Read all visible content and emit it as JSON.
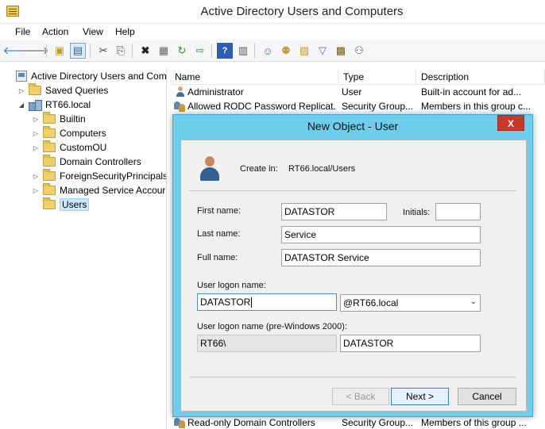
{
  "window": {
    "title": "Active Directory Users and Computers"
  },
  "menu": [
    "File",
    "Action",
    "View",
    "Help"
  ],
  "toolbar": {
    "icons": [
      "back-arrow-icon",
      "forward-arrow-icon",
      "up-folder-icon",
      "show-console-tree-icon",
      "cut-icon",
      "copy-icon",
      "delete-icon",
      "properties-icon",
      "refresh-icon",
      "export-list-icon",
      "help-icon",
      "action-pane-icon",
      "new-user-icon",
      "new-group-icon",
      "new-ou-icon",
      "filter-icon",
      "find-icon",
      "add-to-group-icon"
    ]
  },
  "tree": {
    "root": "Active Directory Users and Com",
    "saved_queries": "Saved Queries",
    "domain": "RT66.local",
    "children": [
      "Builtin",
      "Computers",
      "CustomOU",
      "Domain Controllers",
      "ForeignSecurityPrincipals",
      "Managed Service Accour",
      "Users"
    ]
  },
  "list": {
    "columns": {
      "name": "Name",
      "type": "Type",
      "description": "Description"
    },
    "rows": [
      {
        "name": "Administrator",
        "type": "User",
        "description": "Built-in account for ad..."
      },
      {
        "name": "Allowed RODC Password Replicat...",
        "type": "Security Group...",
        "description": "Members in this group c..."
      },
      {
        "name": "Read-only Domain Controllers",
        "type": "Security Group...",
        "description": "Members of this group ..."
      }
    ]
  },
  "dialog": {
    "title": "New Object - User",
    "close_glyph": "X",
    "create_in_label": "Create in:",
    "create_in_value": "RT66.local/Users",
    "first_name_label": "First name:",
    "first_name_value": "DATASTOR",
    "initials_label": "Initials:",
    "initials_value": "",
    "last_name_label": "Last name:",
    "last_name_value": "Service",
    "full_name_label": "Full name:",
    "full_name_value": "DATASTOR Service",
    "logon_label": "User logon name:",
    "logon_value": "DATASTOR",
    "domain_suffix": "@RT66.local",
    "pre2000_label": "User logon name (pre-Windows 2000):",
    "pre2000_domain": "RT66\\",
    "pre2000_value": "DATASTOR",
    "back_label": "< Back",
    "next_label": "Next >",
    "cancel_label": "Cancel"
  }
}
